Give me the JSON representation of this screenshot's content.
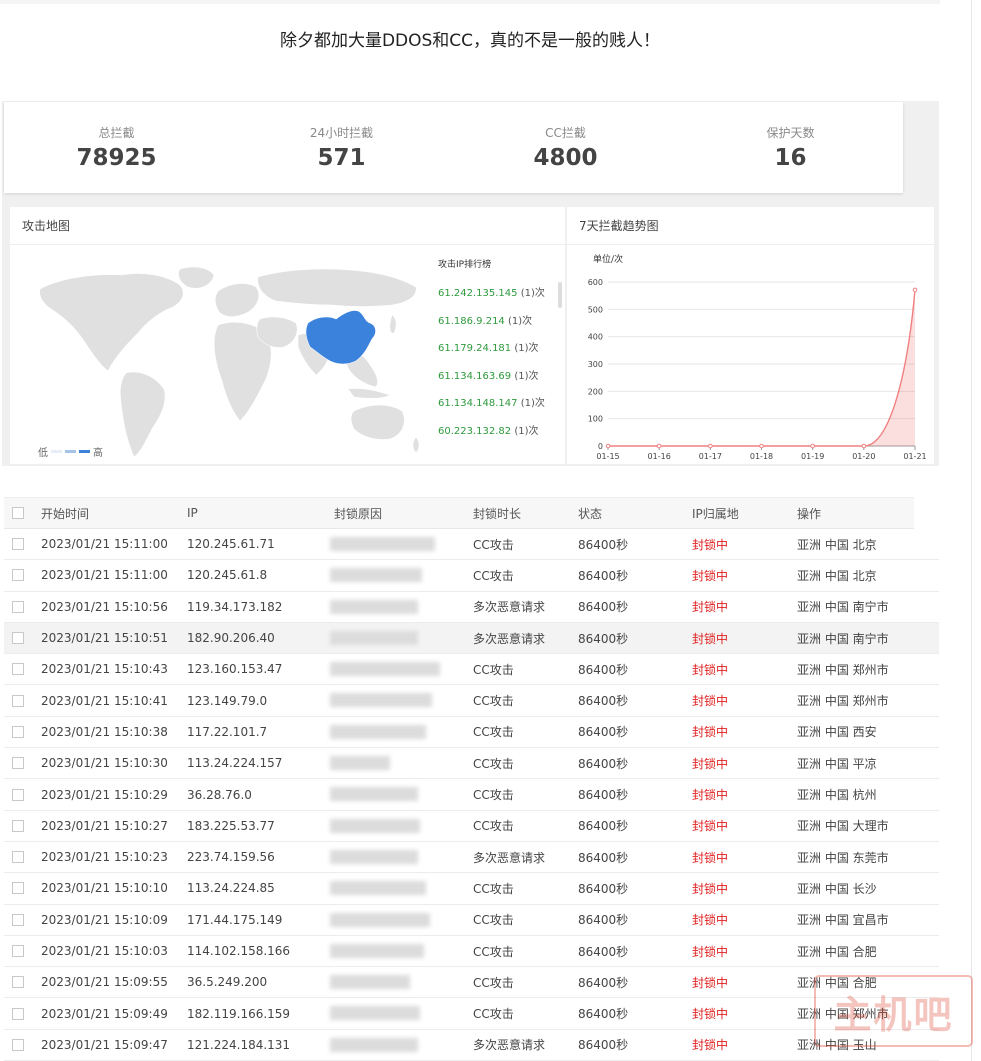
{
  "headline": "除夕都加大量DDOS和CC，真的不是一般的贱人！",
  "stats": [
    {
      "label": "总拦截",
      "value": "78925"
    },
    {
      "label": "24小时拦截",
      "value": "571"
    },
    {
      "label": "CC拦截",
      "value": "4800"
    },
    {
      "label": "保护天数",
      "value": "16"
    }
  ],
  "map_panel": {
    "title": "攻击地图",
    "legend_low": "低",
    "legend_high": "高",
    "legend_colors": [
      "#e8eef7",
      "#a5c3e6",
      "#3b82dc"
    ],
    "highlight_color": "#3b82dc",
    "land_color": "#e0e0e0",
    "rank_title": "攻击IP排行榜",
    "rank": [
      {
        "ip": "61.242.135.145",
        "count": "(1)次"
      },
      {
        "ip": "61.186.9.214",
        "count": "(1)次"
      },
      {
        "ip": "61.179.24.181",
        "count": "(1)次"
      },
      {
        "ip": "61.134.163.69",
        "count": "(1)次"
      },
      {
        "ip": "61.134.148.147",
        "count": "(1)次"
      },
      {
        "ip": "60.223.132.82",
        "count": "(1)次"
      }
    ]
  },
  "trend_panel": {
    "title": "7天拦截趋势图",
    "unit": "单位/次",
    "line_color": "#f08080"
  },
  "chart_data": {
    "type": "area",
    "x": [
      "01-15",
      "01-16",
      "01-17",
      "01-18",
      "01-19",
      "01-20",
      "01-21"
    ],
    "series": [
      {
        "values": [
          0,
          0,
          0,
          0,
          0,
          0,
          571
        ]
      }
    ],
    "ylim": [
      0,
      600
    ],
    "yticks": [
      0,
      100,
      200,
      300,
      400,
      500,
      600
    ],
    "ylabel": "单位/次",
    "grid": true
  },
  "table": {
    "headers": [
      "开始时间",
      "IP",
      "封锁原因",
      "封锁时长",
      "状态",
      "IP归属地",
      "操作"
    ],
    "rows": [
      {
        "time": "2023/01/21 15:11:00",
        "ip": "120.245.61.71",
        "type": "CC攻击",
        "duration": "86400秒",
        "status": "封锁中",
        "location": "亚洲 中国 北京"
      },
      {
        "time": "2023/01/21 15:11:00",
        "ip": "120.245.61.8",
        "type": "CC攻击",
        "duration": "86400秒",
        "status": "封锁中",
        "location": "亚洲 中国 北京"
      },
      {
        "time": "2023/01/21 15:10:56",
        "ip": "119.34.173.182",
        "type": "多次恶意请求",
        "duration": "86400秒",
        "status": "封锁中",
        "location": "亚洲 中国 南宁市"
      },
      {
        "time": "2023/01/21 15:10:51",
        "ip": "182.90.206.40",
        "type": "多次恶意请求",
        "duration": "86400秒",
        "status": "封锁中",
        "location": "亚洲 中国 南宁市"
      },
      {
        "time": "2023/01/21 15:10:43",
        "ip": "123.160.153.47",
        "type": "CC攻击",
        "duration": "86400秒",
        "status": "封锁中",
        "location": "亚洲 中国 郑州市"
      },
      {
        "time": "2023/01/21 15:10:41",
        "ip": "123.149.79.0",
        "type": "CC攻击",
        "duration": "86400秒",
        "status": "封锁中",
        "location": "亚洲 中国 郑州市"
      },
      {
        "time": "2023/01/21 15:10:38",
        "ip": "117.22.101.7",
        "type": "CC攻击",
        "duration": "86400秒",
        "status": "封锁中",
        "location": "亚洲 中国 西安"
      },
      {
        "time": "2023/01/21 15:10:30",
        "ip": "113.24.224.157",
        "type": "CC攻击",
        "duration": "86400秒",
        "status": "封锁中",
        "location": "亚洲 中国 平凉"
      },
      {
        "time": "2023/01/21 15:10:29",
        "ip": "36.28.76.0",
        "type": "CC攻击",
        "duration": "86400秒",
        "status": "封锁中",
        "location": "亚洲 中国 杭州"
      },
      {
        "time": "2023/01/21 15:10:27",
        "ip": "183.225.53.77",
        "type": "CC攻击",
        "duration": "86400秒",
        "status": "封锁中",
        "location": "亚洲 中国 大理市"
      },
      {
        "time": "2023/01/21 15:10:23",
        "ip": "223.74.159.56",
        "type": "多次恶意请求",
        "duration": "86400秒",
        "status": "封锁中",
        "location": "亚洲 中国 东莞市"
      },
      {
        "time": "2023/01/21 15:10:10",
        "ip": "113.24.224.85",
        "type": "CC攻击",
        "duration": "86400秒",
        "status": "封锁中",
        "location": "亚洲 中国 长沙"
      },
      {
        "time": "2023/01/21 15:10:09",
        "ip": "171.44.175.149",
        "type": "CC攻击",
        "duration": "86400秒",
        "status": "封锁中",
        "location": "亚洲 中国 宜昌市"
      },
      {
        "time": "2023/01/21 15:10:03",
        "ip": "114.102.158.166",
        "type": "CC攻击",
        "duration": "86400秒",
        "status": "封锁中",
        "location": "亚洲 中国 合肥"
      },
      {
        "time": "2023/01/21 15:09:55",
        "ip": "36.5.249.200",
        "type": "CC攻击",
        "duration": "86400秒",
        "status": "封锁中",
        "location": "亚洲 中国 合肥"
      },
      {
        "time": "2023/01/21 15:09:49",
        "ip": "182.119.166.159",
        "type": "CC攻击",
        "duration": "86400秒",
        "status": "封锁中",
        "location": "亚洲 中国 郑州市"
      },
      {
        "time": "2023/01/21 15:09:47",
        "ip": "121.224.184.131",
        "type": "多次恶意请求",
        "duration": "86400秒",
        "status": "封锁中",
        "location": "亚洲 中国 玉山"
      }
    ]
  },
  "watermark": "主机吧"
}
